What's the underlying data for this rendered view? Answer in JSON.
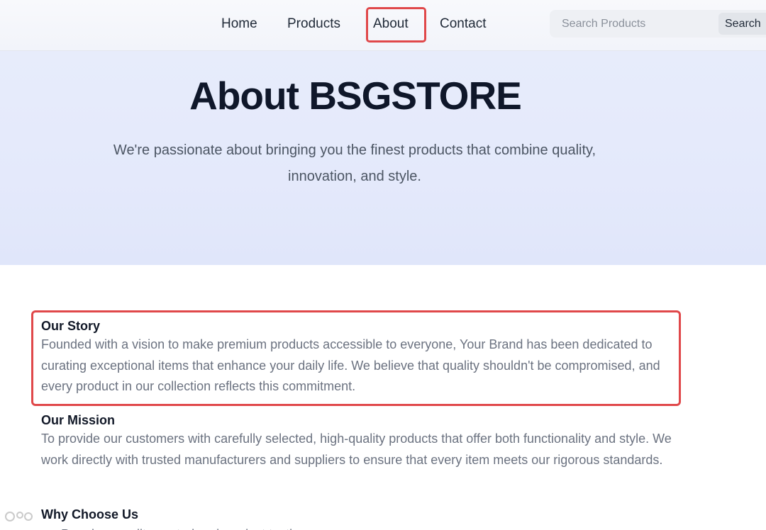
{
  "nav": {
    "items": [
      {
        "label": "Home"
      },
      {
        "label": "Products"
      },
      {
        "label": "About"
      },
      {
        "label": "Contact"
      }
    ]
  },
  "search": {
    "placeholder": "Search Products",
    "button_label": "Search"
  },
  "hero": {
    "title": "About BSGSTORE",
    "subtitle": "We're passionate about bringing you the finest products that combine quality, innovation, and style."
  },
  "sections": {
    "story": {
      "title": "Our Story",
      "body": "Founded with a vision to make premium products accessible to everyone, Your Brand has been dedicated to curating exceptional items that enhance your daily life. We believe that quality shouldn't be compromised, and every product in our collection reflects this commitment."
    },
    "mission": {
      "title": "Our Mission",
      "body": "To provide our customers with carefully selected, high-quality products that offer both functionality and style. We work directly with trusted manufacturers and suppliers to ensure that every item meets our rigorous standards."
    },
    "why": {
      "title": "Why Choose Us",
      "items": [
        "Premium quality control and product testing"
      ]
    }
  },
  "colors": {
    "highlight": "#e0484a",
    "hero_bg": "#e4e9fb"
  }
}
